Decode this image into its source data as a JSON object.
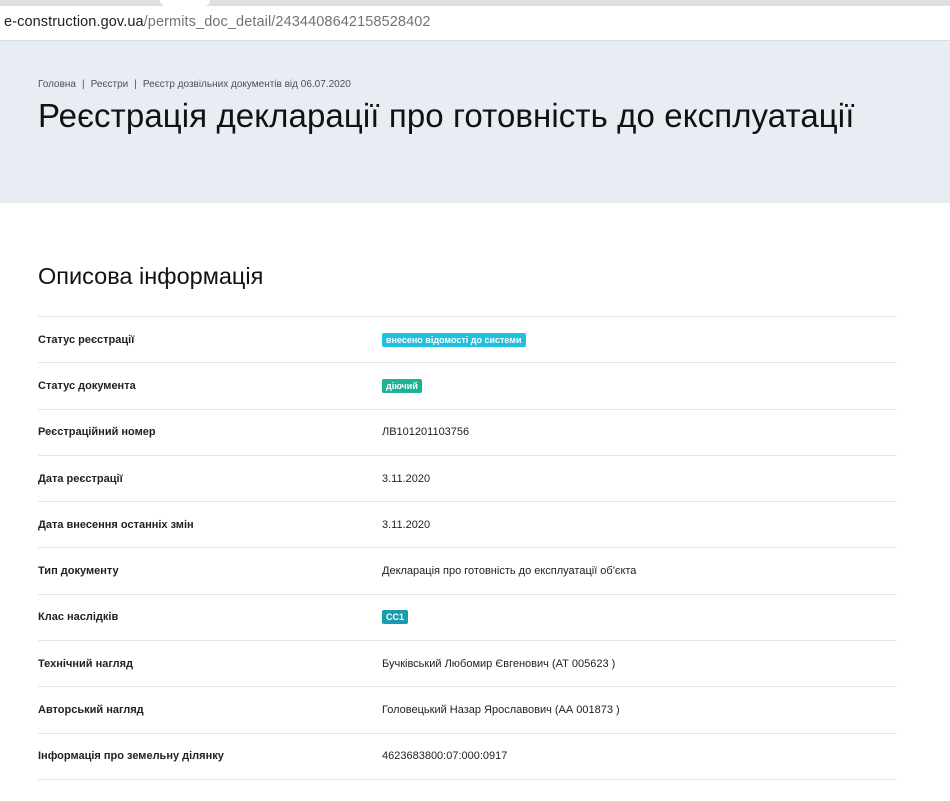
{
  "browser": {
    "url_host": "e-construction.gov.ua",
    "url_path": "/permits_doc_detail/2434408642158528402"
  },
  "breadcrumb": {
    "items": [
      "Головна",
      "Реєстри",
      "Реєстр дозвільних документів від 06.07.2020"
    ]
  },
  "page_title": "Реєстрація декларації про готовність до експлуатації",
  "section_title": "Описова інформація",
  "rows": [
    {
      "label": "Статус реєстрації",
      "value": "внесено відомості до системи",
      "type": "badge",
      "color": "#1fc0e0"
    },
    {
      "label": "Статус документа",
      "value": "діючий",
      "type": "badge",
      "color": "#1ab394"
    },
    {
      "label": "Реєстраційний номер",
      "value": "ЛВ101201103756",
      "type": "text"
    },
    {
      "label": "Дата реєстрації",
      "value": "3.11.2020",
      "type": "text"
    },
    {
      "label": "Дата внесення останніх змін",
      "value": "3.11.2020",
      "type": "text"
    },
    {
      "label": "Тип документу",
      "value": "Декларація про готовність до експлуатації об'єкта",
      "type": "text"
    },
    {
      "label": "Клас наслідків",
      "value": "СС1",
      "type": "badge",
      "color": "#1a9cb0"
    },
    {
      "label": "Технічний нагляд",
      "value": "Бучківський Любомир Євгенович (АТ 005623 )",
      "type": "text"
    },
    {
      "label": "Авторський нагляд",
      "value": "Головецький Назар Ярославович (АА 001873 )",
      "type": "text"
    },
    {
      "label": "Інформація про земельну ділянку",
      "value": "4623683800:07:000:0917",
      "type": "text"
    }
  ]
}
